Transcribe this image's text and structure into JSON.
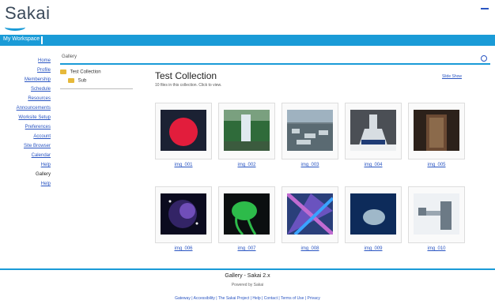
{
  "header": {
    "logo_text": "Sakai"
  },
  "site_bar": {
    "label": "My Workspace"
  },
  "tool_nav": {
    "items": [
      {
        "label": "Home"
      },
      {
        "label": "Profile"
      },
      {
        "label": "Membership"
      },
      {
        "label": "Schedule"
      },
      {
        "label": "Resources"
      },
      {
        "label": "Announcements"
      },
      {
        "label": "Worksite Setup"
      },
      {
        "label": "Preferences"
      },
      {
        "label": "Account"
      },
      {
        "label": "Site Browser"
      },
      {
        "label": "Calendar"
      },
      {
        "label": "Help"
      },
      {
        "label": "Gallery"
      },
      {
        "label": "Help"
      }
    ]
  },
  "breadcrumb": {
    "text": "Gallery"
  },
  "tree": {
    "root_label": "Test Collection",
    "child_label": "Sub"
  },
  "content": {
    "title": "Test Collection",
    "subtitle": "10 files in this collection. Click to view.",
    "right_link": "Slide Show"
  },
  "gallery": {
    "items": [
      {
        "caption": "img_001"
      },
      {
        "caption": "img_002"
      },
      {
        "caption": "img_003"
      },
      {
        "caption": "img_004"
      },
      {
        "caption": "img_005"
      },
      {
        "caption": "img_006"
      },
      {
        "caption": "img_007"
      },
      {
        "caption": "img_008"
      },
      {
        "caption": "img_009"
      },
      {
        "caption": "img_010"
      }
    ]
  },
  "footer": {
    "title": "Gallery - Sakai 2.x",
    "sub": "Powered by Sakai",
    "links": "Gateway | Accessibility | The Sakai Project | Help | Contact | Terms of Use | Privacy"
  }
}
